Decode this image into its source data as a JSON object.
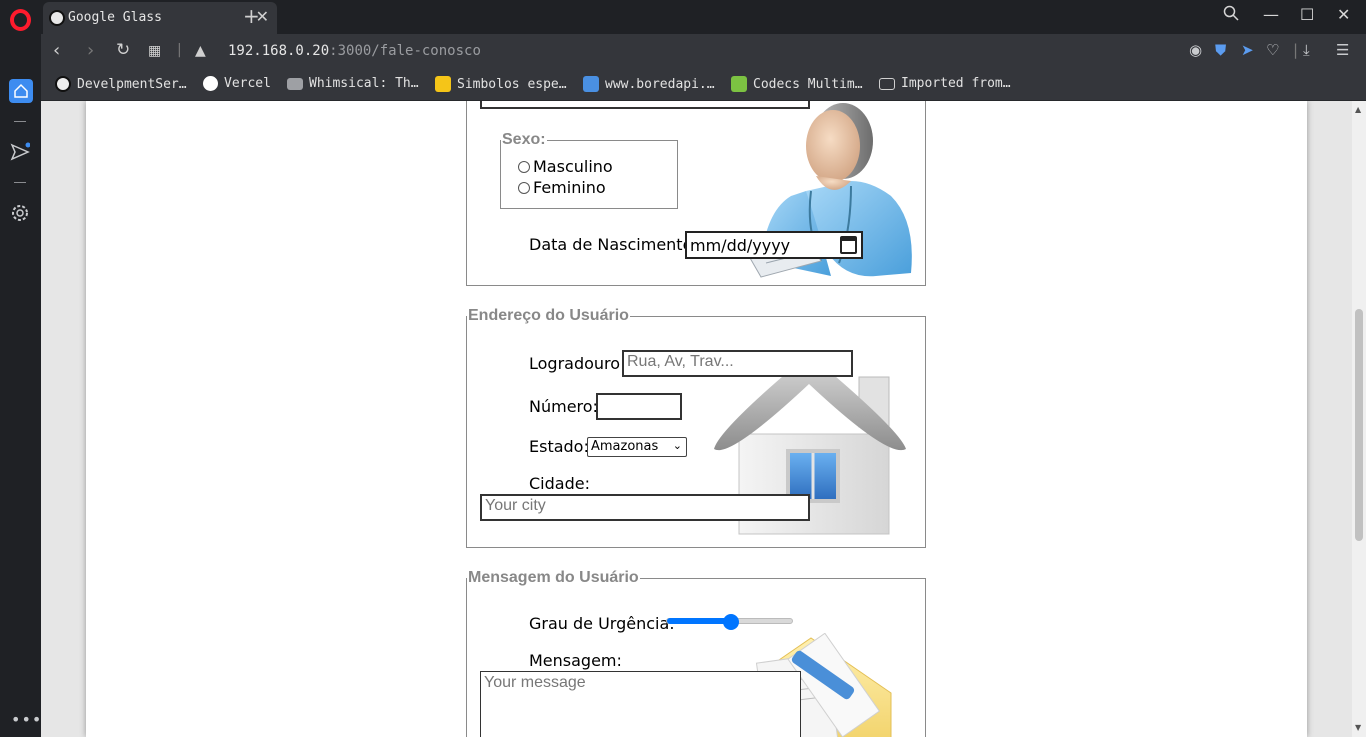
{
  "browser": {
    "tab_title": "Google Glass",
    "url_host": "192.168.0.20",
    "url_port_path": ":3000/fale-conosco",
    "bookmarks": [
      {
        "label": "DevelpmentSer…"
      },
      {
        "label": "Vercel"
      },
      {
        "label": "Whimsical: Th…"
      },
      {
        "label": "Simbolos espe…"
      },
      {
        "label": "www.boredapi.…"
      },
      {
        "label": "Codecs Multim…"
      },
      {
        "label": "Imported from…"
      }
    ]
  },
  "form": {
    "top_section": {
      "sexo_legend": "Sexo:",
      "masculino": "Masculino",
      "feminino": "Feminino",
      "data_label": "Data de Nascimento:",
      "data_value": "mm/dd/yyyy"
    },
    "endereco": {
      "legend": "Endereço do Usuário",
      "logradouro_label": "Logradouro:",
      "logradouro_placeholder": "Rua, Av, Trav...",
      "numero_label": "Número:",
      "estado_label": "Estado:",
      "estado_value": "Amazonas",
      "cidade_label": "Cidade:",
      "cidade_placeholder": "Your city"
    },
    "mensagem": {
      "legend": "Mensagem do Usuário",
      "urgencia_label": "Grau de Urgência:",
      "urgencia_value": 0.5,
      "mensagem_label": "Mensagem:",
      "mensagem_placeholder": "Your message"
    }
  },
  "colors": {
    "accent": "#0075ff",
    "opera_red": "#ff1b2d",
    "sidebar_active": "#3d8cf0"
  }
}
